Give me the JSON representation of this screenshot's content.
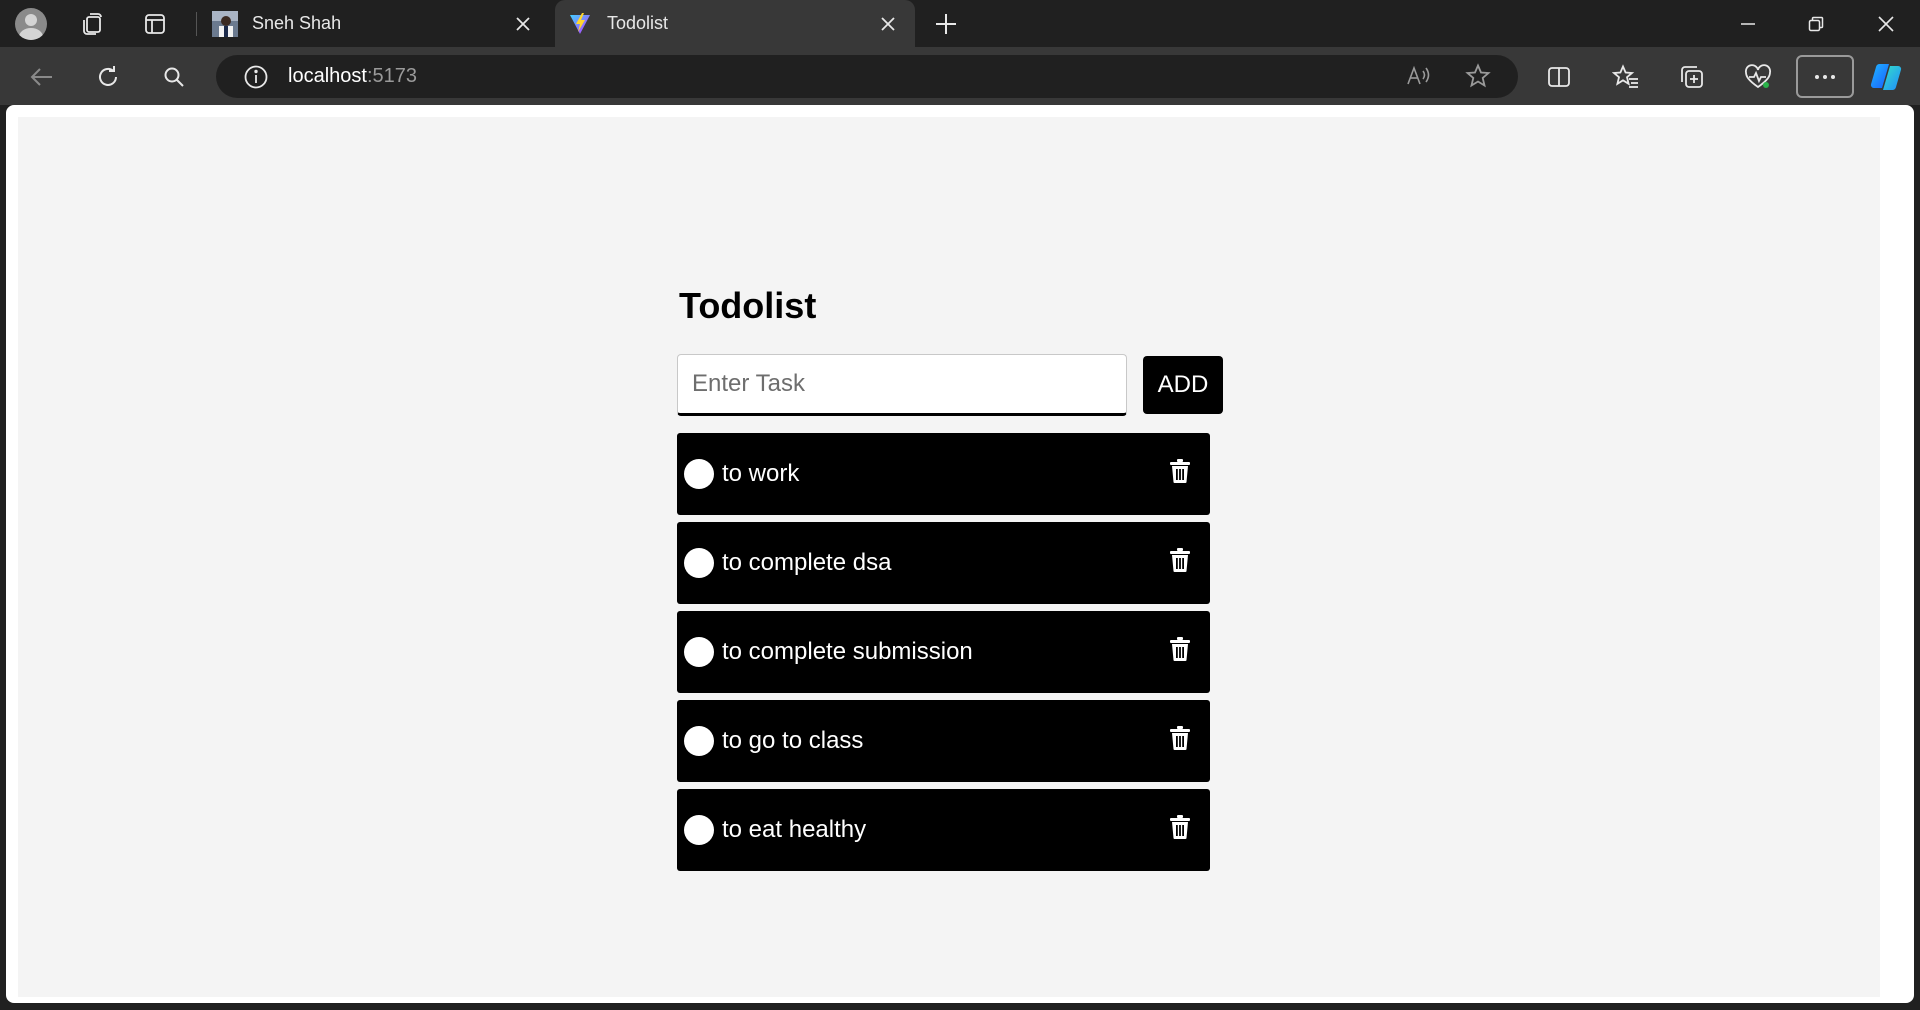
{
  "browser": {
    "tabs": [
      {
        "title": "Sneh Shah",
        "active": false
      },
      {
        "title": "Todolist",
        "active": true
      }
    ],
    "address": {
      "host": "localhost",
      "port": ":5173"
    }
  },
  "app": {
    "title": "Todolist",
    "input_placeholder": "Enter Task",
    "input_value": "",
    "add_label": "ADD",
    "tasks": [
      {
        "text": "to work"
      },
      {
        "text": "to complete dsa"
      },
      {
        "text": "to complete submission"
      },
      {
        "text": "to go to class"
      },
      {
        "text": "to eat healthy"
      }
    ]
  },
  "icons": {
    "profile": "avatar-icon",
    "workspaces": "workspaces-icon",
    "tab_actions": "tab-actions-icon",
    "task_delete": "trash-icon",
    "favicon_active": "vite-logo-icon"
  }
}
